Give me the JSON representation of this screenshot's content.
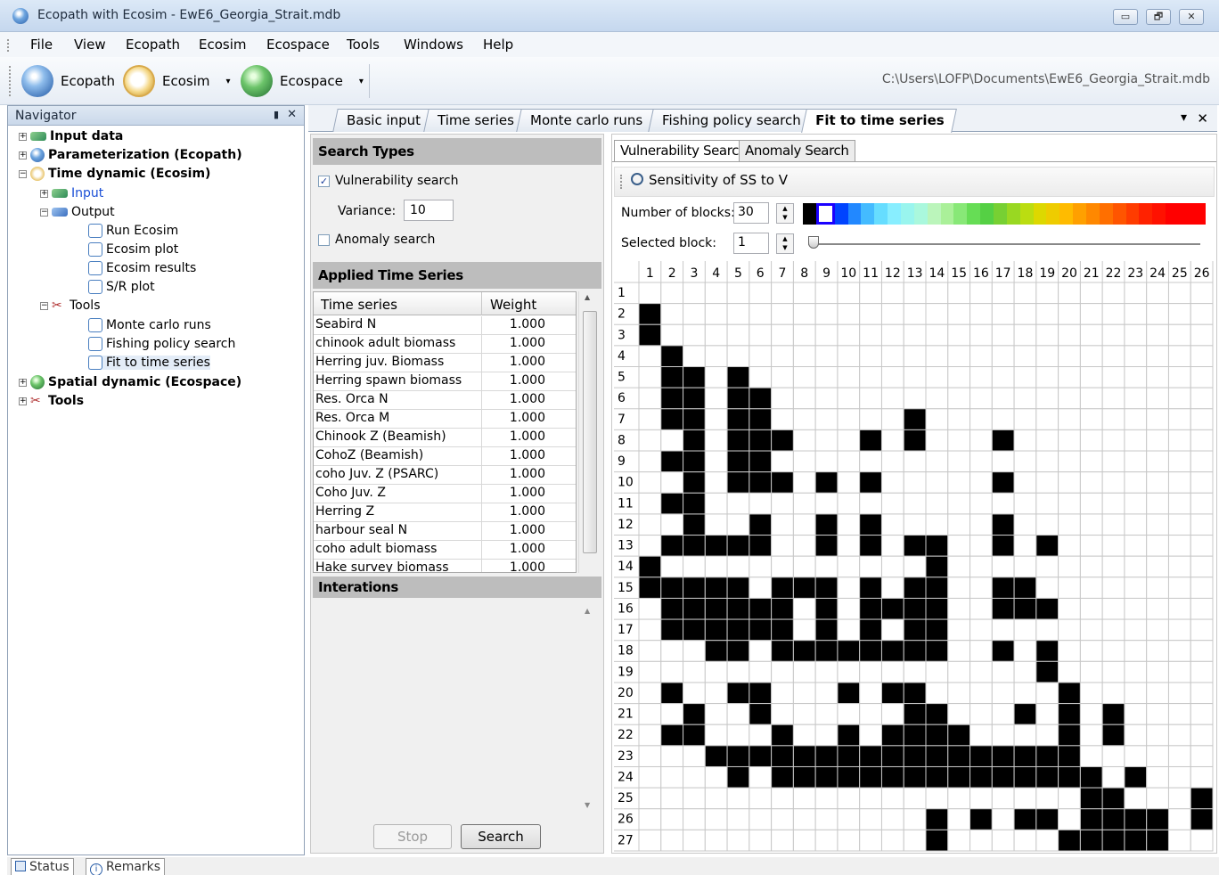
{
  "window": {
    "title": "Ecopath with Ecosim - EwE6_Georgia_Strait.mdb",
    "btn_min": "▭",
    "btn_max": "🗗",
    "btn_close": "✕"
  },
  "menu": [
    "File",
    "View",
    "Ecopath",
    "Ecosim",
    "Ecospace",
    "Tools",
    "Windows",
    "Help"
  ],
  "toolbar": {
    "ecopath": "Ecopath",
    "ecosim": "Ecosim",
    "ecospace": "Ecospace",
    "path": "C:\\Users\\LOFP\\Documents\\EwE6_Georgia_Strait.mdb",
    "caret": "▾"
  },
  "navigator": {
    "title": "Navigator",
    "pin": "▮",
    "close": "✕",
    "items": {
      "input_data": "Input data",
      "parameterization": "Parameterization (Ecopath)",
      "time_dynamic": "Time dynamic (Ecosim)",
      "input": "Input",
      "output": "Output",
      "run_ecosim": "Run Ecosim",
      "ecosim_plot": "Ecosim plot",
      "ecosim_results": "Ecosim results",
      "sr_plot": "S/R plot",
      "tools_sub": "Tools",
      "monte_carlo": "Monte carlo runs",
      "fishing_policy": "Fishing policy search",
      "fit_time_series": "Fit to time series",
      "spatial_dynamic": "Spatial dynamic  (Ecospace)",
      "tools": "Tools"
    },
    "plus": "+",
    "minus": "−"
  },
  "tabs": [
    "Basic input",
    "Time series",
    "Monte carlo runs",
    "Fishing policy search",
    "Fit to time series"
  ],
  "tabs_controls": {
    "dropdown": "▾",
    "close": "✕"
  },
  "left_panel": {
    "search_types_header": "Search Types",
    "vulnerability_search": "Vulnerability search",
    "vulnerability_checked": "✓",
    "variance_label": "Variance:",
    "variance_value": "10",
    "anomaly_search": "Anomaly search",
    "applied_header": "Applied Time Series",
    "col_time_series": "Time series",
    "col_weight": "Weight",
    "rows": [
      {
        "name": "Seabird N",
        "weight": "1.000"
      },
      {
        "name": "chinook adult biomass",
        "weight": "1.000"
      },
      {
        "name": "Herring juv. Biomass",
        "weight": "1.000"
      },
      {
        "name": "Herring spawn biomass",
        "weight": "1.000"
      },
      {
        "name": "Res. Orca N",
        "weight": "1.000"
      },
      {
        "name": "Res. Orca M",
        "weight": "1.000"
      },
      {
        "name": "Chinook Z (Beamish)",
        "weight": "1.000"
      },
      {
        "name": "CohoZ (Beamish)",
        "weight": "1.000"
      },
      {
        "name": "coho Juv. Z (PSARC)",
        "weight": "1.000"
      },
      {
        "name": "Coho Juv. Z",
        "weight": "1.000"
      },
      {
        "name": "Herring Z",
        "weight": "1.000"
      },
      {
        "name": "harbour seal N",
        "weight": "1.000"
      },
      {
        "name": "coho adult biomass",
        "weight": "1.000"
      },
      {
        "name": "Hake survey biomass",
        "weight": "1.000"
      }
    ],
    "interations_header": "Interations",
    "stop_button": "Stop",
    "search_button": "Search",
    "scroll_up": "▲",
    "scroll_down": "▼"
  },
  "right_panel": {
    "subtabs": [
      "Vulnerability Search",
      "Anomaly Search"
    ],
    "sensitivity_label": "Sensitivity of SS to V",
    "num_blocks_label": "Number of blocks:",
    "num_blocks_value": "30",
    "selected_block_label": "Selected block:",
    "selected_block_value": "1",
    "spin_up": "▲",
    "spin_down": "▼",
    "selected_block_fraction": 0.0
  },
  "matrix": {
    "cols": 26,
    "rows": 27,
    "filled": {
      "2": [
        1
      ],
      "3": [
        1
      ],
      "4": [
        2
      ],
      "5": [
        2,
        3,
        5
      ],
      "6": [
        2,
        3,
        5,
        6
      ],
      "7": [
        2,
        3,
        5,
        6,
        13
      ],
      "8": [
        3,
        5,
        6,
        7,
        11,
        13,
        17
      ],
      "9": [
        2,
        3,
        5,
        6
      ],
      "10": [
        3,
        5,
        6,
        7,
        9,
        11,
        17
      ],
      "11": [
        2,
        3
      ],
      "12": [
        3,
        6,
        9,
        11,
        17
      ],
      "13": [
        2,
        3,
        4,
        5,
        6,
        9,
        11,
        13,
        14,
        17,
        19
      ],
      "14": [
        1,
        14
      ],
      "15": [
        1,
        2,
        3,
        4,
        5,
        7,
        8,
        9,
        11,
        13,
        14,
        17,
        18
      ],
      "16": [
        2,
        3,
        4,
        5,
        6,
        7,
        9,
        11,
        12,
        13,
        14,
        17,
        18,
        19
      ],
      "17": [
        2,
        3,
        4,
        5,
        6,
        7,
        9,
        11,
        13,
        14
      ],
      "18": [
        4,
        5,
        7,
        8,
        9,
        10,
        11,
        12,
        13,
        14,
        17,
        19
      ],
      "19": [
        19
      ],
      "20": [
        2,
        5,
        6,
        10,
        12,
        13,
        20
      ],
      "21": [
        3,
        6,
        13,
        14,
        18,
        20,
        22
      ],
      "22": [
        2,
        3,
        7,
        10,
        12,
        13,
        14,
        15,
        20,
        22
      ],
      "23": [
        4,
        5,
        6,
        7,
        8,
        9,
        10,
        11,
        12,
        13,
        14,
        15,
        16,
        17,
        18,
        19,
        20
      ],
      "24": [
        5,
        7,
        8,
        9,
        10,
        11,
        12,
        13,
        14,
        15,
        16,
        17,
        18,
        19,
        20,
        21,
        23
      ],
      "25": [
        21,
        22,
        26
      ],
      "26": [
        14,
        16,
        18,
        19,
        21,
        22,
        23,
        24,
        26
      ],
      "27": [
        14,
        20,
        21,
        22,
        23,
        24
      ]
    },
    "palette": [
      "#000000",
      "#1a00ff",
      "#0044ff",
      "#2288ff",
      "#44bbff",
      "#66ddff",
      "#88eeff",
      "#99f5ee",
      "#aaf8dd",
      "#bbf5bb",
      "#aaf099",
      "#88e877",
      "#66dd55",
      "#55d044",
      "#77d033",
      "#99d822",
      "#bbdd11",
      "#ddd800",
      "#eecc00",
      "#ffbb00",
      "#ffa000",
      "#ff8800",
      "#ff6f00",
      "#ff5500",
      "#ff3c00",
      "#ff2200",
      "#ff1100",
      "#ff0000",
      "#ff0000",
      "#ff0000"
    ]
  },
  "status": {
    "status": "Status",
    "remarks": "Remarks"
  }
}
